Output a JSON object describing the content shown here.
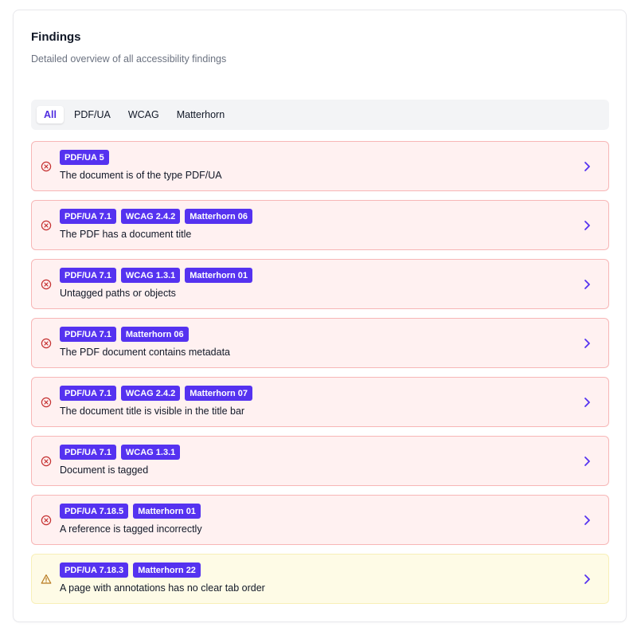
{
  "header": {
    "title": "Findings",
    "subtitle": "Detailed overview of all accessibility findings"
  },
  "tabs": [
    {
      "label": "All",
      "active": true
    },
    {
      "label": "PDF/UA",
      "active": false
    },
    {
      "label": "WCAG",
      "active": false
    },
    {
      "label": "Matterhorn",
      "active": false
    }
  ],
  "colors": {
    "accent": "#5532f0",
    "error_bg": "#fff1f1",
    "error_border": "#f7b6b6",
    "error_icon": "#c53030",
    "warning_bg": "#fefbe6",
    "warning_icon": "#b7791f"
  },
  "findings": [
    {
      "severity": "error",
      "icon": "x-circle-icon",
      "badges": [
        "PDF/UA 5"
      ],
      "text": "The document is of the type PDF/UA"
    },
    {
      "severity": "error",
      "icon": "x-circle-icon",
      "badges": [
        "PDF/UA 7.1",
        "WCAG 2.4.2",
        "Matterhorn 06"
      ],
      "text": "The PDF has a document title"
    },
    {
      "severity": "error",
      "icon": "x-circle-icon",
      "badges": [
        "PDF/UA 7.1",
        "WCAG 1.3.1",
        "Matterhorn 01"
      ],
      "text": "Untagged paths or objects"
    },
    {
      "severity": "error",
      "icon": "x-circle-icon",
      "badges": [
        "PDF/UA 7.1",
        "Matterhorn 06"
      ],
      "text": "The PDF document contains metadata"
    },
    {
      "severity": "error",
      "icon": "x-circle-icon",
      "badges": [
        "PDF/UA 7.1",
        "WCAG 2.4.2",
        "Matterhorn 07"
      ],
      "text": "The document title is visible in the title bar"
    },
    {
      "severity": "error",
      "icon": "x-circle-icon",
      "badges": [
        "PDF/UA 7.1",
        "WCAG 1.3.1"
      ],
      "text": "Document is tagged"
    },
    {
      "severity": "error",
      "icon": "x-circle-icon",
      "badges": [
        "PDF/UA 7.18.5",
        "Matterhorn 01"
      ],
      "text": "A reference is tagged incorrectly"
    },
    {
      "severity": "warning",
      "icon": "warning-triangle-icon",
      "badges": [
        "PDF/UA 7.18.3",
        "Matterhorn 22"
      ],
      "text": "A page with annotations has no clear tab order"
    }
  ]
}
